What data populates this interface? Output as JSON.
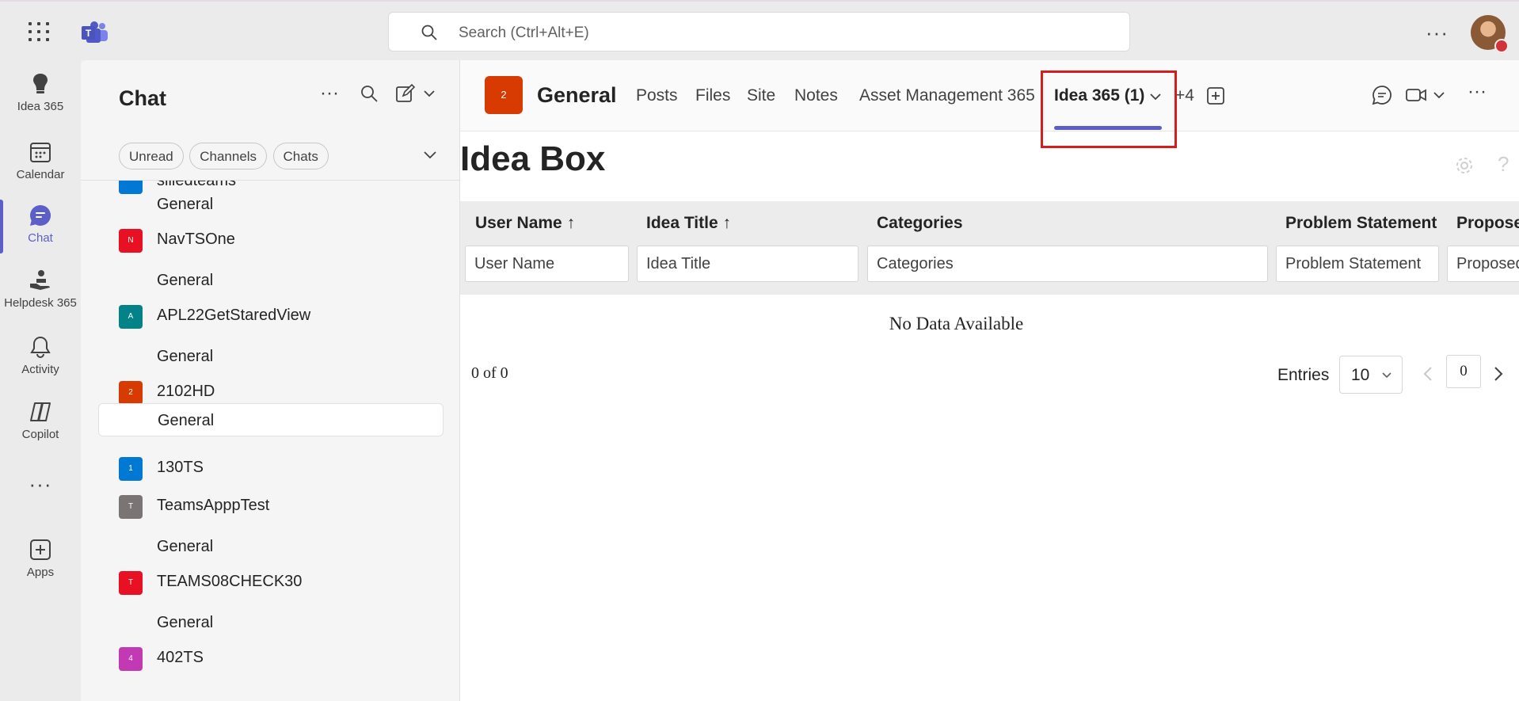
{
  "topbar": {
    "search_placeholder": "Search (Ctrl+Alt+E)",
    "more_label": "···"
  },
  "rail": {
    "items": [
      {
        "label": "Idea 365",
        "icon": "idea-365-app-icon"
      },
      {
        "label": "Calendar",
        "icon": "calendar-icon"
      },
      {
        "label": "Chat",
        "icon": "chat-icon",
        "active": true
      },
      {
        "label": "Helpdesk 365",
        "icon": "helpdesk-icon"
      },
      {
        "label": "Activity",
        "icon": "bell-icon"
      },
      {
        "label": "Copilot",
        "icon": "copilot-icon"
      },
      {
        "label": "···",
        "icon": "more-icon"
      },
      {
        "label": "Apps",
        "icon": "add-apps-icon"
      }
    ]
  },
  "chat": {
    "title": "Chat",
    "filters": [
      "Unread",
      "Channels",
      "Chats"
    ],
    "list": {
      "partial_team": "sliiedteams",
      "ch1": "General",
      "t1": {
        "name": "NavTSOne",
        "initial": "N",
        "color": "#e81123"
      },
      "ch2": "General",
      "t2": {
        "name": "APL22GetStaredView",
        "initial": "A",
        "color": "#038387"
      },
      "ch3": "General",
      "t3": {
        "name": "2102HD",
        "initial": "2",
        "color": "#d83b01"
      },
      "ch4": "General",
      "t4": {
        "name": "130TS",
        "initial": "1",
        "color": "#0078d4"
      },
      "t5": {
        "name": "TeamsApppTest",
        "initial": "T",
        "color": "#7a7574"
      },
      "ch5": "General",
      "t6": {
        "name": "TEAMS08CHECK30",
        "initial": "T",
        "color": "#e81123"
      },
      "ch6": "General",
      "t7": {
        "name": "402TS",
        "initial": "4",
        "color": "#c239b3"
      }
    }
  },
  "channel_header": {
    "badge": "2",
    "title": "General",
    "tabs": {
      "posts": "Posts",
      "files": "Files",
      "site": "Site",
      "notes": "Notes",
      "asset": "Asset Management 365",
      "idea": "Idea 365 (1)",
      "overflow": "+4"
    },
    "accent": "#5b5fc7",
    "highlight_color": "#d41e1e"
  },
  "idea_box": {
    "title": "Idea Box",
    "columns": {
      "user_name": "User Name",
      "idea_title": "Idea Title",
      "categories": "Categories",
      "problem": "Problem Statement",
      "proposed": "Proposed"
    },
    "filters": {
      "user_name": "User Name",
      "idea_title": "Idea Title",
      "categories": "Categories",
      "problem": "Problem Statement",
      "proposed": "Proposed"
    },
    "empty_text": "No Data Available",
    "count_text": "0 of 0",
    "entries_label": "Entries",
    "entries_value": "10",
    "page_value": "0"
  }
}
